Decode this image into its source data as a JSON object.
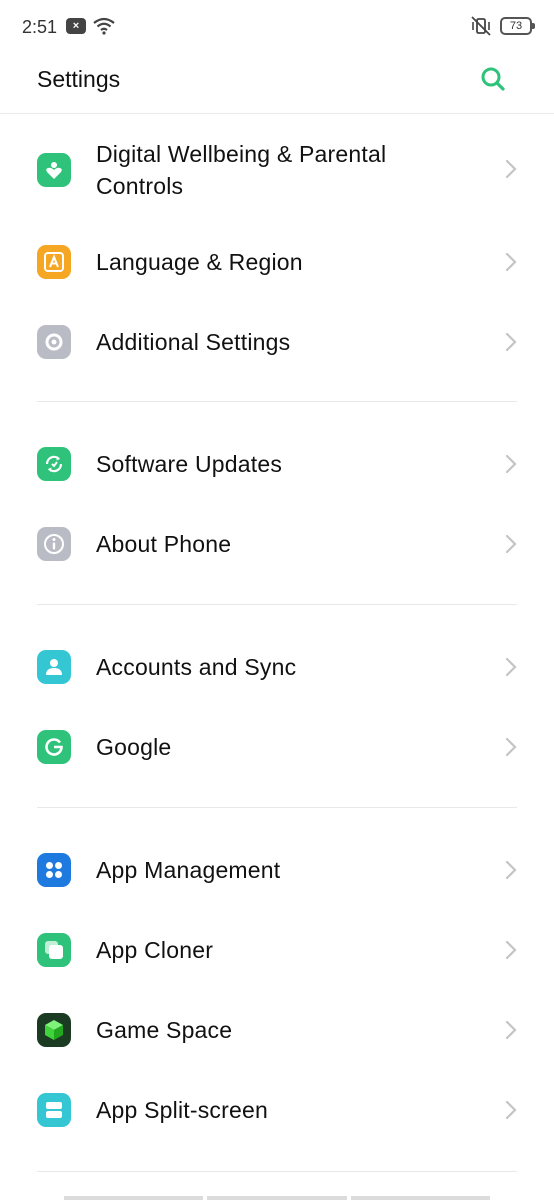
{
  "status": {
    "time": "2:51",
    "battery": "73"
  },
  "header": {
    "title": "Settings"
  },
  "items": [
    {
      "label_line1": "Digital Wellbeing & Parental",
      "label_line2": "Controls",
      "icon": "heart-person-icon",
      "color": "#2fc27a"
    },
    {
      "label": "Language & Region",
      "icon": "letter-a-icon",
      "color": "#f5a623"
    },
    {
      "label": "Additional Settings",
      "icon": "gear-icon",
      "color": "#b9bcc4"
    },
    {
      "label": "Software Updates",
      "icon": "refresh-icon",
      "color": "#2fc27a"
    },
    {
      "label": "About Phone",
      "icon": "info-icon",
      "color": "#b9bcc4"
    },
    {
      "label": "Accounts and Sync",
      "icon": "person-icon",
      "color": "#35c6d4"
    },
    {
      "label": "Google",
      "icon": "google-icon",
      "color": "#2fc27a"
    },
    {
      "label": "App Management",
      "icon": "apps-grid-icon",
      "color": "#1f7ae0"
    },
    {
      "label": "App Cloner",
      "icon": "clone-icon",
      "color": "#2fc27a"
    },
    {
      "label": "Game Space",
      "icon": "cube-icon",
      "color": "#1b3b22"
    },
    {
      "label": "App Split-screen",
      "icon": "split-screen-icon",
      "color": "#35c6d4"
    }
  ]
}
